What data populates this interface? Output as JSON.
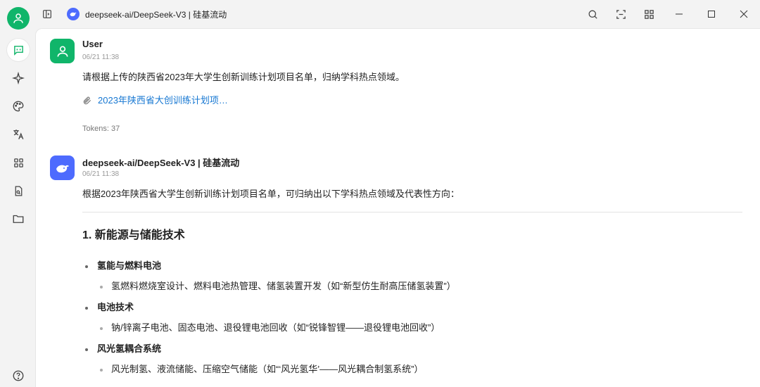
{
  "window": {
    "tab_title": "deepseek-ai/DeepSeek-V3 | 硅基流动"
  },
  "rail": {
    "items": [
      "chat-icon",
      "sparkle-icon",
      "palette-icon",
      "translate-icon",
      "apps-icon",
      "document-icon",
      "folder-icon",
      "help-icon"
    ]
  },
  "messages": [
    {
      "name": "User",
      "time": "06/21 11:38",
      "text": "请根据上传的陕西省2023年大学生创新训练计划项目名单，归纳学科热点领域。",
      "attachment": "2023年陕西省大创训练计划项…",
      "tokens": "Tokens: 37"
    },
    {
      "name": "deepseek-ai/DeepSeek-V3 | 硅基流动",
      "time": "06/21 11:38",
      "intro": "根据2023年陕西省大学生创新训练计划项目名单，可归纳出以下学科热点领域及代表性方向：",
      "section_title": "1. 新能源与储能技术",
      "items": [
        {
          "title": "氢能与燃料电池",
          "detail": "氢燃料燃烧室设计、燃料电池热管理、储氢装置开发（如“新型仿生耐高压储氢装置”）"
        },
        {
          "title": "电池技术",
          "detail": "钠/锌离子电池、固态电池、退役锂电池回收（如“锐锋智锂——退役锂电池回收”）"
        },
        {
          "title": "风光氢耦合系统",
          "detail": "风光制氢、液流储能、压缩空气储能（如“‘风光氢华’——风光耦合制氢系统”）"
        }
      ]
    }
  ],
  "colors": {
    "accent_green": "#10b56a",
    "accent_blue": "#4d6bfe",
    "link": "#1677d2"
  }
}
